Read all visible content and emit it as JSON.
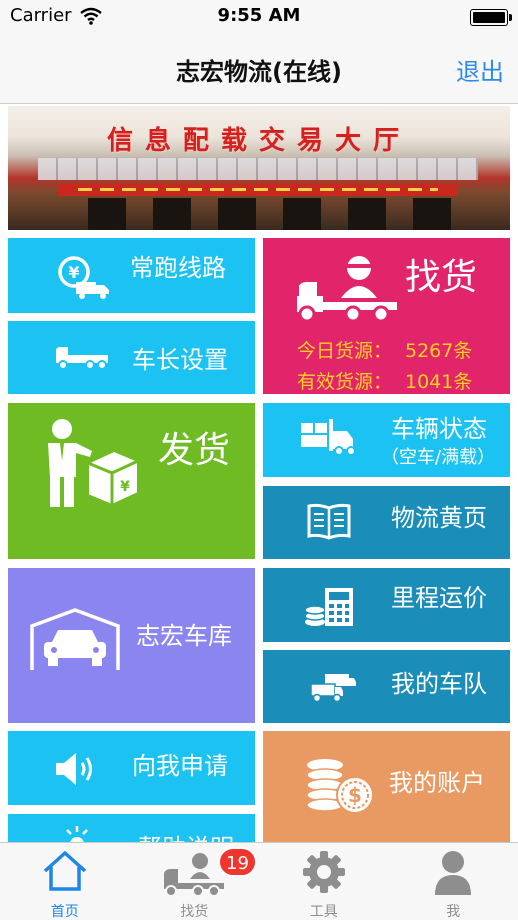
{
  "status_bar": {
    "carrier": "Carrier",
    "time": "9:55 AM"
  },
  "nav": {
    "title": "志宏物流(在线)",
    "logout_label": "退出"
  },
  "banner": {
    "text": "信息配载交易大厅"
  },
  "tiles": {
    "routes": {
      "label": "常跑线路",
      "color": "#1cc3f2"
    },
    "find_goods": {
      "label": "找货",
      "today_label": "今日货源：",
      "today_value": "5267条",
      "valid_label": "有效货源：",
      "valid_value": "1041条",
      "color": "#e2246b",
      "stats_color": "#ffd21f"
    },
    "truck_length": {
      "label": "车长设置",
      "color": "#1cc3f2"
    },
    "ship": {
      "label": "发货",
      "color": "#6fbb24"
    },
    "vehicle_status": {
      "label": "车辆状态",
      "sub": "（空车/满载）",
      "color": "#1cc3f2"
    },
    "yellow_pages": {
      "label": "物流黄页",
      "color": "#1a8db8"
    },
    "garage": {
      "label": "志宏车库",
      "color": "#8b86ef"
    },
    "mileage": {
      "label": "里程运价",
      "color": "#1a8db8"
    },
    "fleet": {
      "label": "我的车队",
      "color": "#1a8db8"
    },
    "apply": {
      "label": "向我申请",
      "color": "#1cc3f2"
    },
    "account": {
      "label": "我的账户",
      "color": "#e99a62"
    },
    "help": {
      "label": "帮助说明",
      "color": "#1cc3f2"
    }
  },
  "tabbar": {
    "tabs": [
      {
        "label": "首页",
        "icon": "home-icon",
        "active": true
      },
      {
        "label": "找货",
        "icon": "truck-driver-icon",
        "badge": "19"
      },
      {
        "label": "工具",
        "icon": "gear-icon"
      },
      {
        "label": "我",
        "icon": "person-icon"
      }
    ],
    "active_color": "#1e87e5",
    "inactive_color": "#8e8e8e"
  }
}
